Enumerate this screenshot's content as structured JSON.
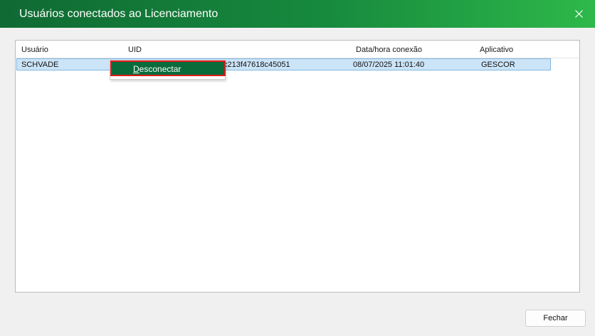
{
  "window": {
    "title": "Usuários conectados ao Licenciamento"
  },
  "grid": {
    "columns": [
      "Usuário",
      "UID",
      "Data/hora conexão",
      "Aplicativo"
    ],
    "rows": [
      {
        "usuario": "SCHVADE",
        "uid": "c213f47618c45051",
        "data_hora": "08/07/2025 11:01:40",
        "aplicativo": "GESCOR",
        "selected": true
      }
    ]
  },
  "context_menu": {
    "items": [
      "Desconectar"
    ],
    "highlight_color": "#0a6b3a",
    "outline_color": "#e01a1a"
  },
  "footer": {
    "close_label": "Fechar"
  },
  "colors": {
    "titlebar_start": "#0f6a33",
    "titlebar_end": "#2eb84a",
    "selection": "#cce4f7"
  }
}
